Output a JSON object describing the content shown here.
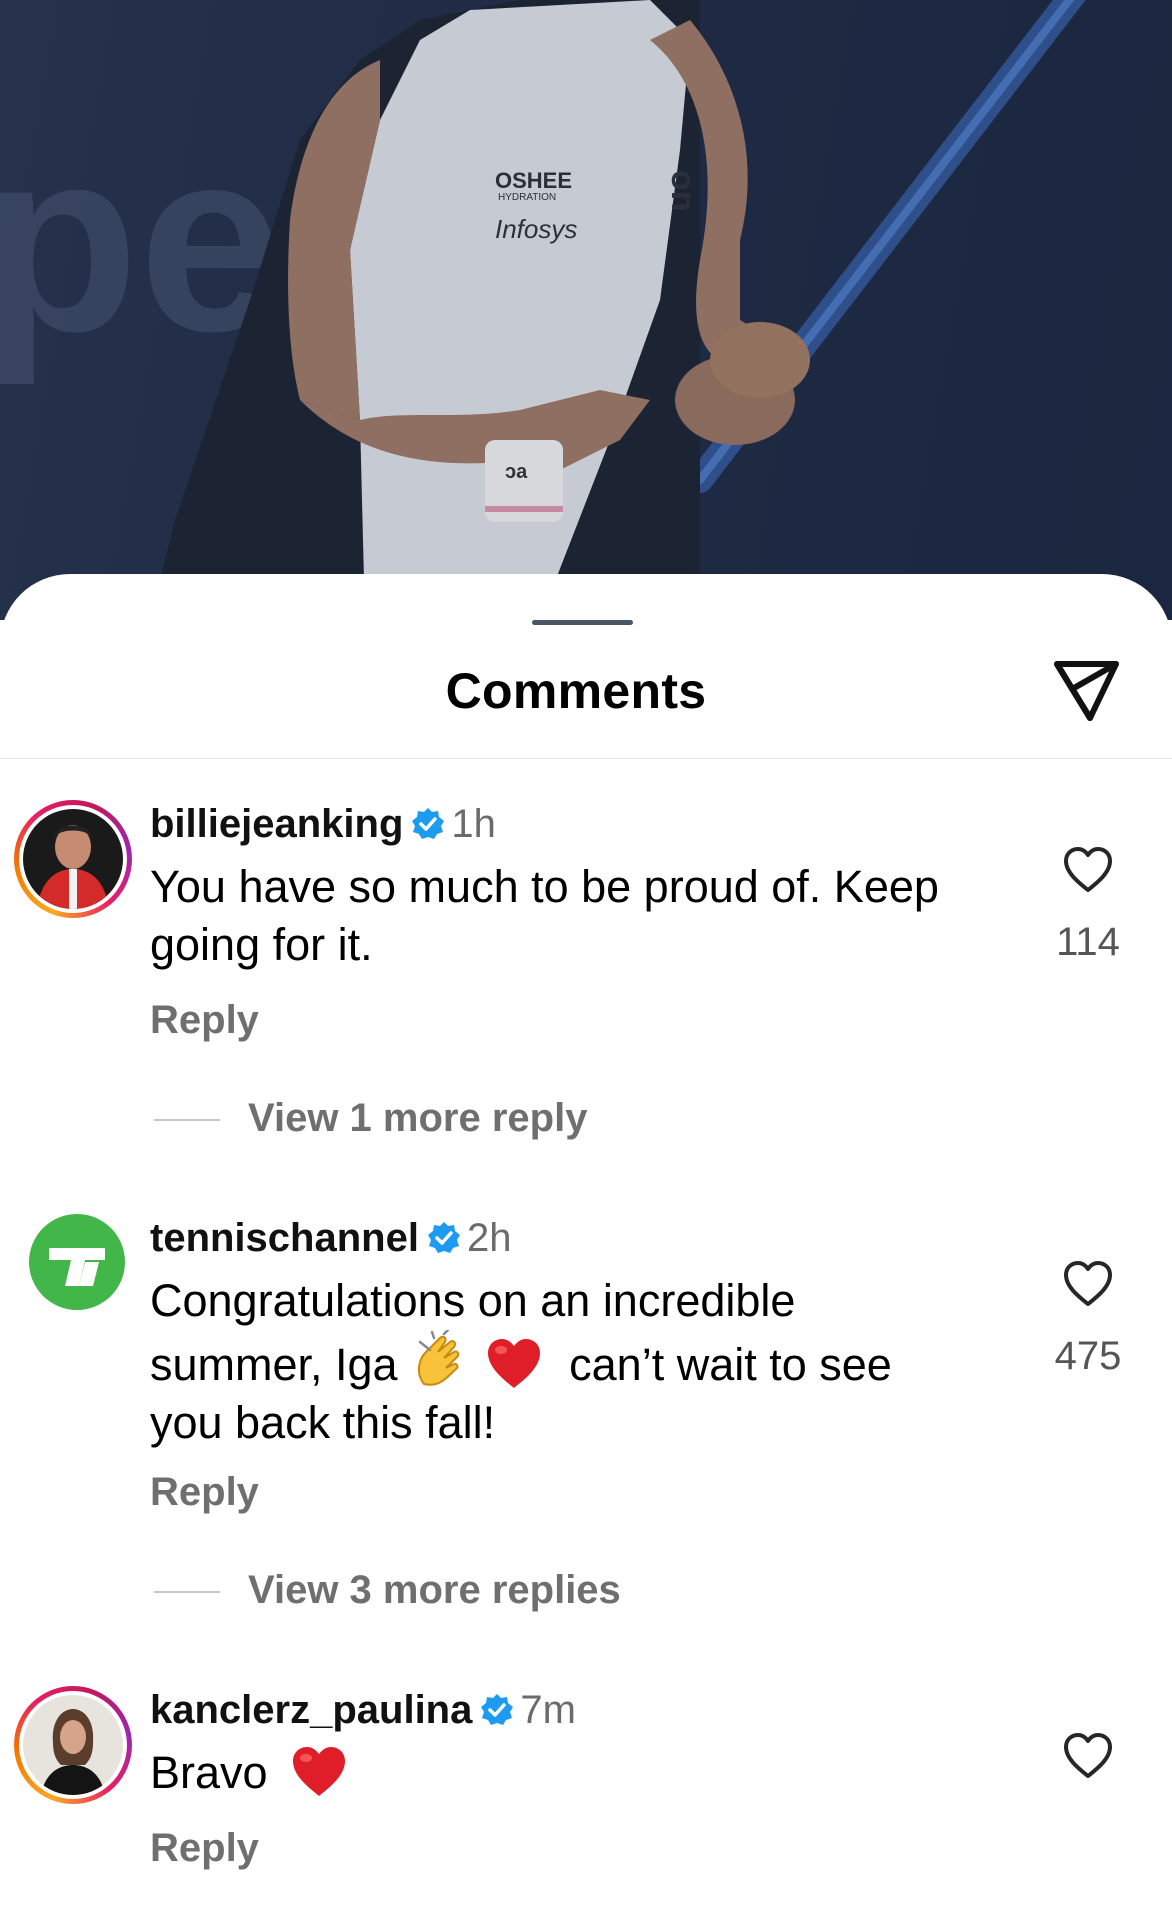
{
  "sheet": {
    "title": "Comments",
    "send_icon": "paper-plane-icon"
  },
  "comments": [
    {
      "username": "billiejeanking",
      "verified": true,
      "time": "1h",
      "text": "You have so much to be proud of. Keep going for it.",
      "reply_label": "Reply",
      "more_replies": "View 1 more reply",
      "likes": "114"
    },
    {
      "username": "tennischannel",
      "verified": true,
      "time": "2h",
      "text_part1": "Congratulations on an incredible summer, Iga",
      "text_part2": "can’t wait to see you back this fall!",
      "emojis": [
        "clapping-hands-emoji",
        "red-heart-emoji"
      ],
      "reply_label": "Reply",
      "more_replies": "View 3 more replies",
      "likes": "475"
    },
    {
      "username": "kanclerz_paulina",
      "verified": true,
      "time": "7m",
      "text": "Bravo",
      "emojis": [
        "red-heart-emoji"
      ],
      "reply_label": "Reply",
      "likes": ""
    }
  ],
  "colors": {
    "verified_badge": "#1d9bf0",
    "muted_text": "#6f6f6f",
    "heart_emoji": "#e01e2a",
    "tennischannel_green": "#43b649"
  },
  "photo": {
    "shirt_text_1": "OSHEE",
    "shirt_text_2": "HYDRATION",
    "shirt_text_3": "Infosys",
    "logo_text": "on"
  }
}
